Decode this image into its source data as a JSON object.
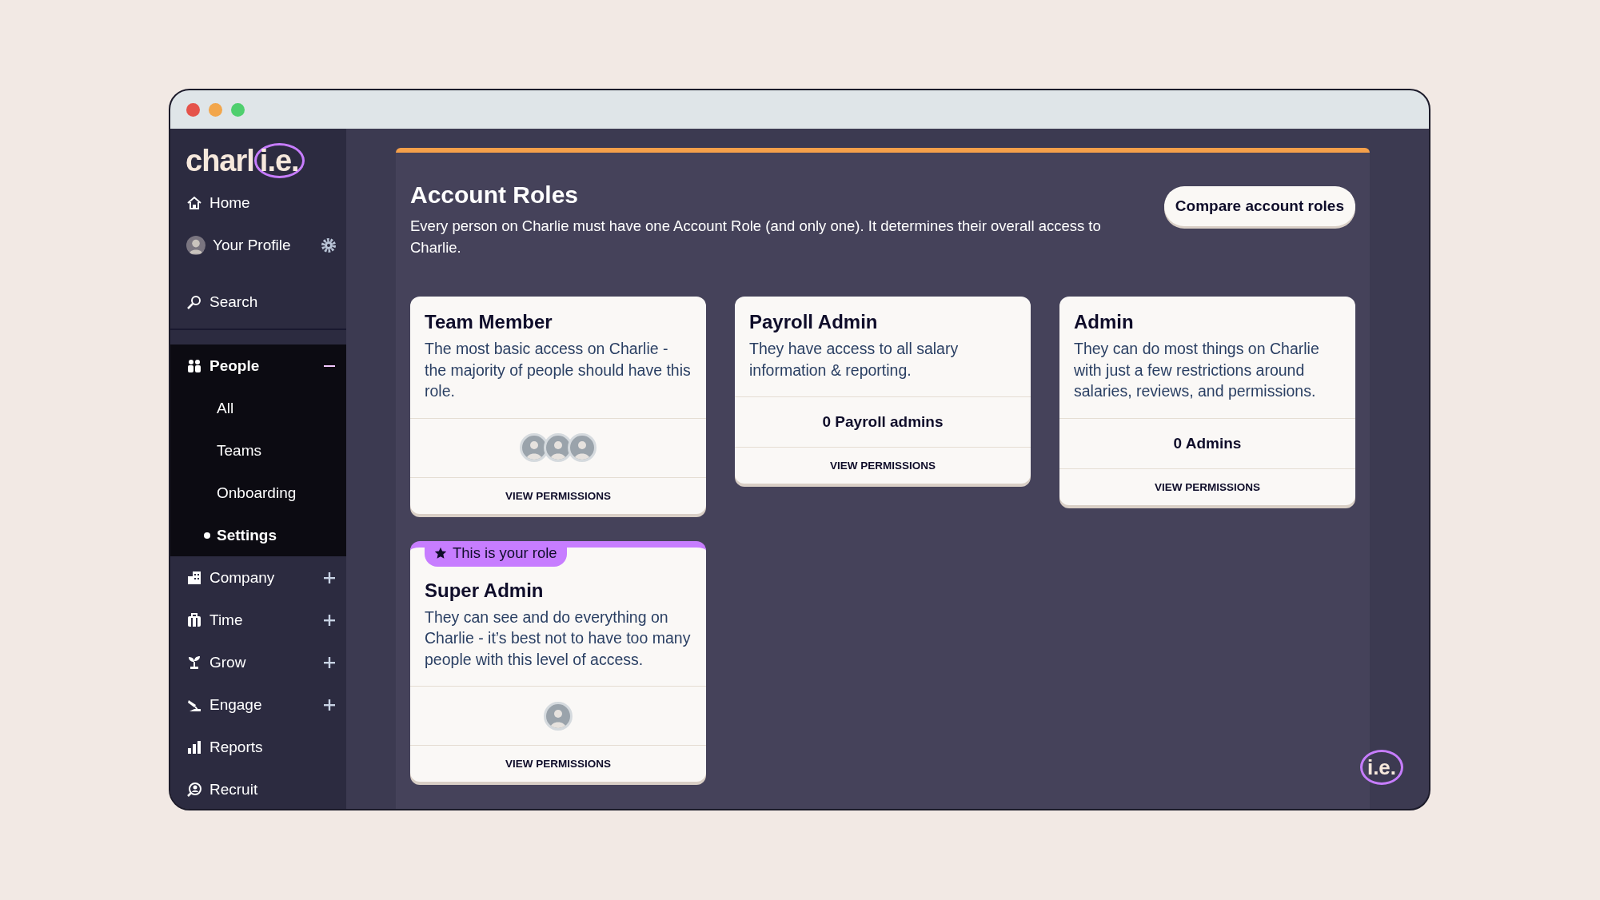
{
  "sidebar": {
    "logo": {
      "text": "charl",
      "mark": "i.e."
    },
    "top_items": [
      {
        "kind": "link",
        "label": "Home"
      },
      {
        "kind": "profile",
        "label": "Your Profile"
      },
      {
        "kind": "search",
        "label": "Search"
      }
    ],
    "sections": [
      {
        "label": "People",
        "expanded": true,
        "children": [
          {
            "label": "All",
            "selected": false
          },
          {
            "label": "Teams",
            "selected": false
          },
          {
            "label": "Onboarding",
            "selected": false
          },
          {
            "label": "Settings",
            "selected": true
          }
        ]
      },
      {
        "label": "Company",
        "expanded": false
      },
      {
        "label": "Time",
        "expanded": false
      },
      {
        "label": "Grow",
        "expanded": false
      },
      {
        "label": "Engage",
        "expanded": false
      },
      {
        "label": "Reports"
      },
      {
        "label": "Recruit"
      }
    ]
  },
  "main": {
    "title": "Account Roles",
    "description": "Every person on Charlie must have one Account Role (and only one). It determines their overall access to Charlie.",
    "compare_button": "Compare account roles",
    "roles": [
      {
        "title": "Team Member",
        "description": "The most basic access on Charlie - the majority of people should have this role.",
        "current": false,
        "footer": {
          "kind": "avatars",
          "avatars": [
            {
              "kind": "photo"
            },
            {
              "kind": "photo"
            },
            {
              "kind": "photo"
            }
          ]
        },
        "action": "VIEW PERMISSIONS"
      },
      {
        "title": "Payroll Admin",
        "description": "They have access to all salary information & reporting.",
        "current": false,
        "footer": {
          "kind": "count",
          "text": "0 Payroll admins"
        },
        "action": "VIEW PERMISSIONS"
      },
      {
        "title": "Admin",
        "description": "They can do most things on Charlie with just a few restrictions around salaries, reviews, and permissions.",
        "current": false,
        "footer": {
          "kind": "count",
          "text": "0 Admins"
        },
        "action": "VIEW PERMISSIONS"
      },
      {
        "title": "Super Admin",
        "description": "They can see and do everything on Charlie - it’s best not to have too many people with this level of access.",
        "current": true,
        "badge": "This is your role",
        "footer": {
          "kind": "avatars",
          "avatars": [
            {
              "kind": "photo"
            }
          ]
        },
        "action": "VIEW PERMISSIONS"
      }
    ],
    "help_button": "i.e."
  }
}
